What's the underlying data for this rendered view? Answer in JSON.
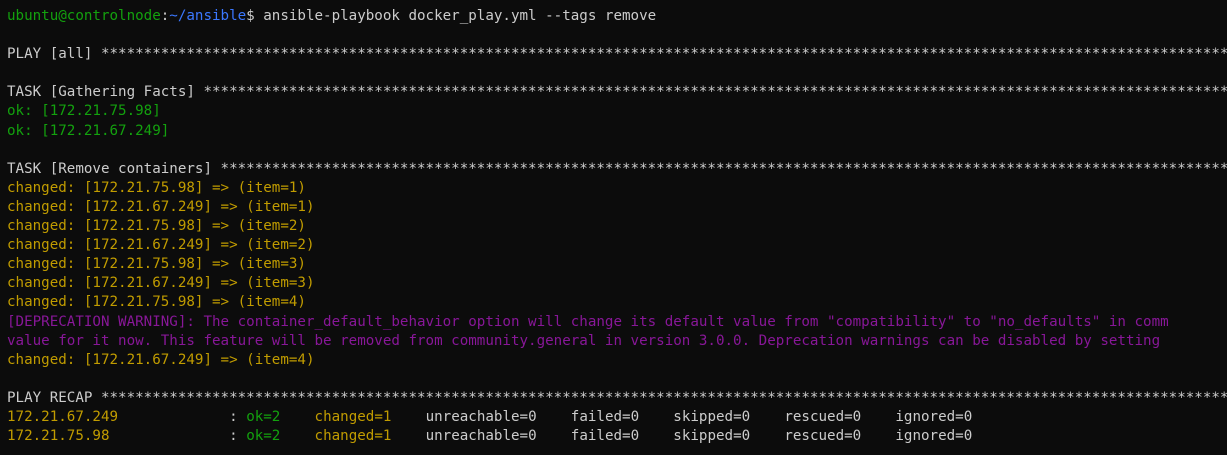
{
  "prompt": {
    "user_host": "ubuntu@controlnode",
    "colon": ":",
    "path": "~/ansible",
    "dollar": "$",
    "command": " ansible-playbook docker_play.yml --tags remove"
  },
  "play_header": "PLAY [all] **************************************************************************************************************************************",
  "task_gather_header": "TASK [Gathering Facts] **************************************************************************************************************************",
  "gather_results": [
    "ok: [172.21.75.98]",
    "ok: [172.21.67.249]"
  ],
  "task_remove_header": "TASK [Remove containers] ************************************************************************************************************************",
  "remove_results_before": [
    "changed: [172.21.75.98] => (item=1)",
    "changed: [172.21.67.249] => (item=1)",
    "changed: [172.21.75.98] => (item=2)",
    "changed: [172.21.67.249] => (item=2)",
    "changed: [172.21.75.98] => (item=3)",
    "changed: [172.21.67.249] => (item=3)",
    "changed: [172.21.75.98] => (item=4)"
  ],
  "deprecation_lines": [
    "[DEPRECATION WARNING]: The container_default_behavior option will change its default value from \"compatibility\" to \"no_defaults\" in comm",
    "value for it now. This feature will be removed from community.general in version 3.0.0. Deprecation warnings can be disabled by setting"
  ],
  "remove_results_after": [
    "changed: [172.21.67.249] => (item=4)"
  ],
  "recap_header": "PLAY RECAP **************************************************************************************************************************************",
  "recap_rows": [
    {
      "host": "172.21.67.249             ",
      "sep": ": ",
      "ok": "ok=2",
      "gap1": "    ",
      "changed": "changed=1",
      "rest": "    unreachable=0    failed=0    skipped=0    rescued=0    ignored=0"
    },
    {
      "host": "172.21.75.98              ",
      "sep": ": ",
      "ok": "ok=2",
      "gap1": "    ",
      "changed": "changed=1",
      "rest": "    unreachable=0    failed=0    skipped=0    rescued=0    ignored=0"
    }
  ],
  "colors": {
    "background": "#0c0c0c",
    "foreground": "#cccccc",
    "ok_green": "#13a10e",
    "path_blue": "#3b78ff",
    "changed_yellow": "#c19c00",
    "warning_magenta": "#881798"
  }
}
